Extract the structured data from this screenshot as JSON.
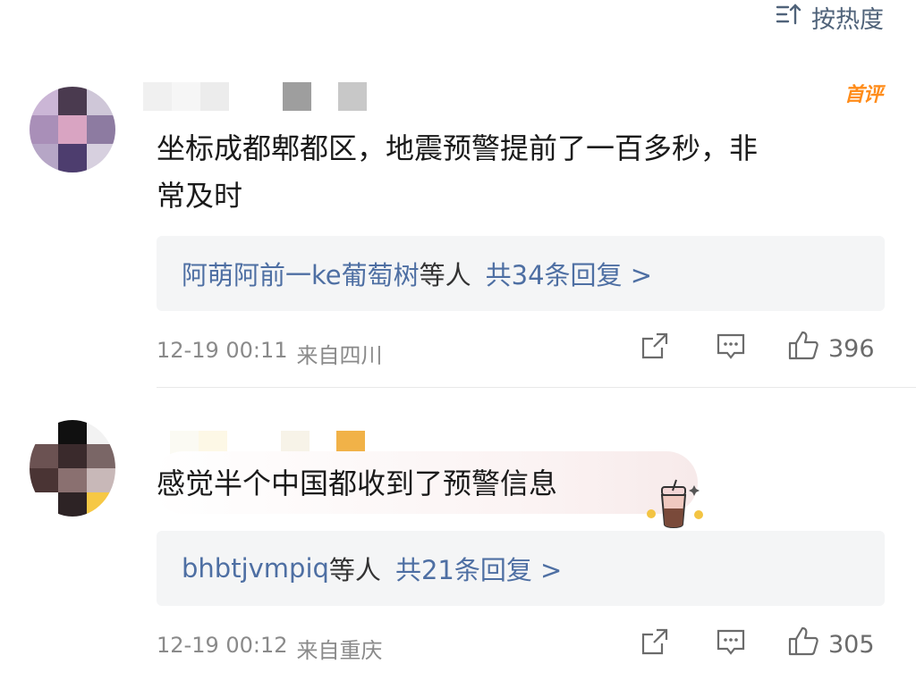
{
  "sort": {
    "label": "按热度",
    "icon": "sort-icon"
  },
  "comments": [
    {
      "badge": "首评",
      "content_line1": "坐标成都郫都区，地震预警提前了一百多秒，非",
      "content_line2": "常及时",
      "reply_names": "阿萌阿前一ke葡萄树",
      "reply_mid": "等人",
      "reply_count": "共34条回复 >",
      "time": "12-19 00:11",
      "location": "来自四川",
      "likes": "396"
    },
    {
      "content_line1": "感觉半个中国都收到了预警信息",
      "reply_names": "bhbtjvmpiq",
      "reply_mid": "等人",
      "reply_count": "共21条回复 >",
      "time": "12-19 00:12",
      "location": "来自重庆",
      "likes": "305"
    }
  ],
  "icons": {
    "share": "share-icon",
    "comment": "comment-icon",
    "like": "thumbs-up-icon"
  },
  "colors": {
    "link": "#4e6fa3",
    "badge": "#ff8c1a",
    "meta": "#8a8a8a",
    "reply_bg": "#f4f5f6"
  }
}
